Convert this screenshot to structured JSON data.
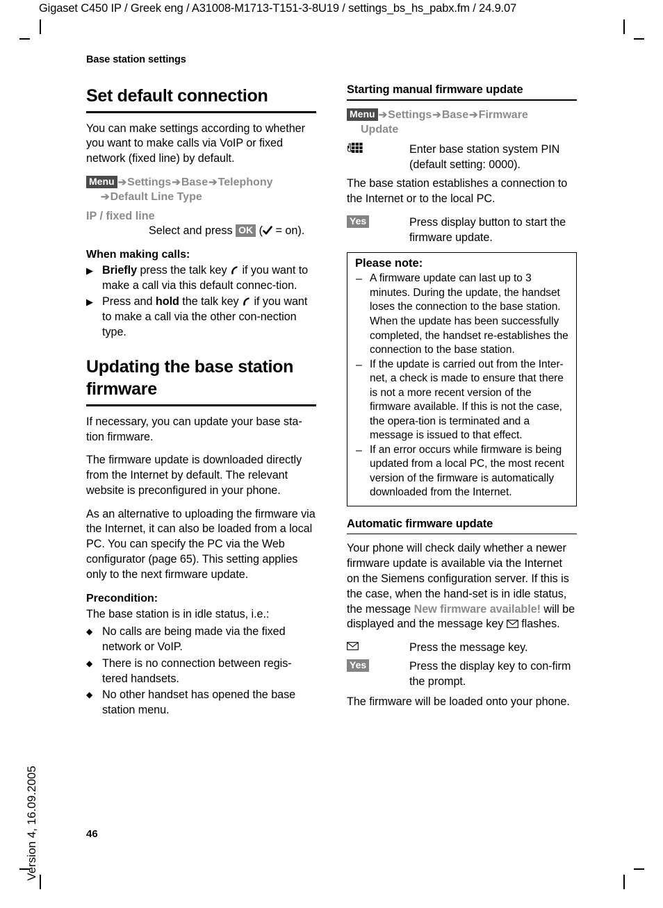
{
  "header": {
    "running_head": "Gigaset C450 IP / Greek eng / A31008-M1713-T151-3-8U19 / settings_bs_hs_pabx.fm / 24.9.07"
  },
  "footer": {
    "version": "Version 4, 16.09.2005",
    "page_number": "46"
  },
  "left_column": {
    "section_label": "Base station settings",
    "title": "Set default connection",
    "intro": "You can make settings according to whether you want to make calls via VoIP or fixed network (fixed line) by default.",
    "menu_path": {
      "badge": "Menu",
      "arrow": "➔",
      "items": [
        "Settings",
        "Base",
        "Telephony"
      ],
      "continuation": "Default Line Type"
    },
    "option_label": "IP / fixed line",
    "option_action_pre": "Select and press ",
    "option_badge": "OK",
    "option_action_post": " = on).",
    "making_calls_heading": "When making calls:",
    "making_calls": [
      {
        "bold_lead": "Briefly",
        "text_before_icon": " press the talk key ",
        "icon": "talk-key-icon",
        "text_after_icon": " if you want to make a call via this default connec-tion."
      },
      {
        "bold_lead": "",
        "text_before_icon": "Press and ",
        "bold_mid": "hold",
        "text_mid": " the talk key ",
        "icon": "talk-key-icon",
        "text_after_icon": " if you want to make a call via the other con-nection type."
      }
    ],
    "title2": "Updating the base station firmware",
    "paragraphs": [
      "If necessary, you can update your base sta-tion firmware.",
      "The firmware update is downloaded directly from the Internet by default. The relevant website is preconfigured in your phone.",
      "As an alternative to uploading the firmware via the Internet, it can also be loaded from a local PC. You can specify the PC via the Web configurator (page 65). This setting applies only to the next firmware update."
    ],
    "precondition_heading": "Precondition:",
    "precondition_intro": "The base station is in idle status, i.e.:",
    "precondition_items": [
      "No calls are being made via the fixed network or VoIP.",
      "There is no connection between regis-tered handsets.",
      "No other handset has opened the base station menu."
    ]
  },
  "right_column": {
    "title": "Starting manual firmware update",
    "menu_path": {
      "badge": "Menu",
      "arrow": "➔",
      "items": [
        "Settings",
        "Base",
        "Firmware"
      ],
      "continuation": "Update"
    },
    "pin_row": {
      "icon": "keypad-icon",
      "text": "Enter base station system PIN (default setting: 0000)."
    },
    "connection_paragraph": "The base station establishes a connection to the Internet or to the local PC.",
    "yes_row": {
      "badge": "Yes",
      "text": "Press display button to start the firmware update."
    },
    "note": {
      "heading": "Please note:",
      "items": [
        "A firmware update can last up to 3 minutes. During the update, the handset loses the connection to the base station. When the update has been successfully completed, the handset re-establishes the connection to the base station.",
        "If the update is carried out from the Inter-net, a check is made to ensure that there is not a more recent version of the firmware available. If this is not the case, the opera-tion is terminated and a message is issued to that effect.",
        "If an error occurs while firmware is being updated from a local PC, the most recent version of the firmware is automatically downloaded from the Internet."
      ]
    },
    "title2": "Automatic firmware update",
    "auto_paragraph_1": "Your phone will check daily whether a newer firmware update is available via the Internet on the Siemens configuration server. If this is the case, when the hand-set is in idle status, the message ",
    "auto_message_highlight": "New firmware available!",
    "auto_paragraph_2": " will be displayed and the message key ",
    "auto_paragraph_3": " flashes.",
    "msg_row": {
      "icon": "envelope-icon",
      "text": "Press the message key."
    },
    "yes_row2": {
      "badge": "Yes",
      "text": "Press the display key to con-firm the prompt."
    },
    "closing_paragraph": "The firmware will be loaded onto your phone."
  },
  "colors": {
    "menu_gray": "#8c8c8c",
    "badge_dark": "#4a4a4a",
    "badge_light": "#838383",
    "rule_black": "#000000"
  }
}
